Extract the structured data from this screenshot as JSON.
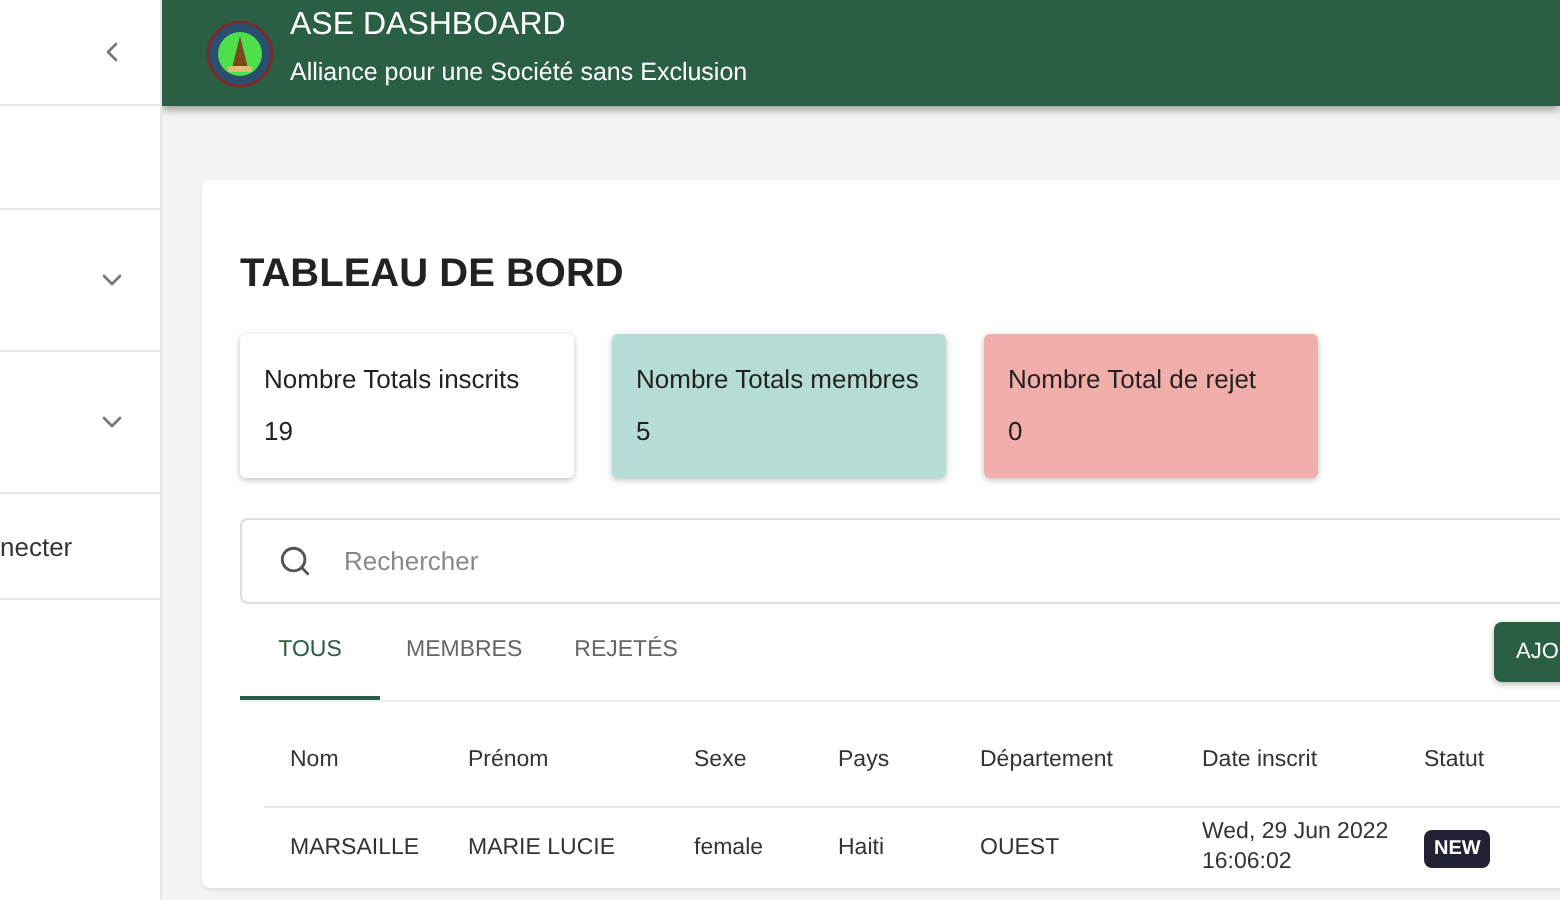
{
  "sidebar": {
    "items": [
      {
        "kind": "collapse"
      },
      {
        "kind": "blank"
      },
      {
        "kind": "expand"
      },
      {
        "kind": "expand"
      },
      {
        "kind": "text",
        "label": "necter"
      }
    ]
  },
  "header": {
    "title": "ASE DASHBOARD",
    "subtitle": "Alliance pour une Société sans Exclusion"
  },
  "page_title": "TABLEAU DE BORD",
  "stats": [
    {
      "label": "Nombre Totals inscrits",
      "value": "19",
      "color": "#ffffff"
    },
    {
      "label": "Nombre Totals membres",
      "value": "5",
      "color": "#b5ddd6"
    },
    {
      "label": "Nombre Total de rejet",
      "value": "0",
      "color": "#f2aeaa"
    }
  ],
  "search": {
    "placeholder": "Rechercher"
  },
  "tabs": [
    {
      "label": "TOUS",
      "selected": true
    },
    {
      "label": "MEMBRES",
      "selected": false
    },
    {
      "label": "REJETÉS",
      "selected": false
    }
  ],
  "add_button": "AJO",
  "table": {
    "columns": [
      "Nom",
      "Prénom",
      "Sexe",
      "Pays",
      "Département",
      "Date inscrit",
      "Statut"
    ],
    "rows": [
      {
        "cells": [
          "MARSAILLE",
          "MARIE LUCIE",
          "female",
          "Haiti",
          "OUEST",
          "Wed, 29 Jun 2022 16:06:02"
        ],
        "status": "NEW"
      }
    ]
  }
}
